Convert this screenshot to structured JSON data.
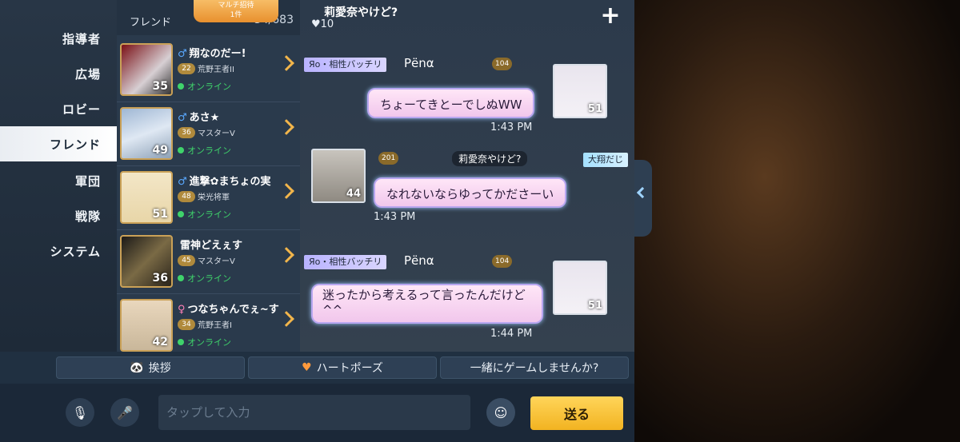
{
  "nav": {
    "items": [
      {
        "label": "指導者"
      },
      {
        "label": "広場"
      },
      {
        "label": "ロビー"
      },
      {
        "label": "フレンド",
        "active": true
      },
      {
        "label": "軍団"
      },
      {
        "label": "戦隊"
      },
      {
        "label": "システム"
      }
    ]
  },
  "friends": {
    "title": "フレンド",
    "count": "34/683",
    "multi_badge_line1": "マルチ招待",
    "multi_badge_line2": "1件",
    "list": [
      {
        "gender": "♂",
        "name": "翔なのだー!",
        "star": "22",
        "rank": "荒野王者II",
        "status": "オンライン",
        "level": "35"
      },
      {
        "gender": "♂",
        "name": "あさ★",
        "star": "36",
        "rank": "マスターV",
        "status": "オンライン",
        "level": "49"
      },
      {
        "gender": "♂",
        "name": "進撃✿まちょの実",
        "star": "48",
        "rank": "栄光将軍",
        "status": "オンライン",
        "level": "51"
      },
      {
        "gender": "",
        "name": "雷神どえぇす",
        "star": "45",
        "rank": "マスターV",
        "status": "オンライン",
        "level": "36"
      },
      {
        "gender": "♀",
        "name": "つなちゃんでぇ~す",
        "star": "34",
        "rank": "荒野王者I",
        "status": "オンライン",
        "level": "42"
      }
    ]
  },
  "chat": {
    "title": "莉愛奈やけど?",
    "hearts": "♥10",
    "messages": [
      {
        "tag": "Яo・相性バッチリ",
        "user": "Pёnα",
        "star": "104",
        "text": "ちょーてきとーでしぬWW",
        "time": "1:43 PM",
        "level": "51"
      },
      {
        "star": "201",
        "user": "莉愛奈やけど?",
        "tag": "大翔だじ",
        "text": "なれないならゆってかださーい",
        "time": "1:43 PM",
        "level": "44"
      },
      {
        "tag": "Яo・相性バッチリ",
        "user": "Pёnα",
        "star": "104",
        "text": "迷ったから考えるって言ったんだけど^^",
        "time": "1:44 PM",
        "level": "51"
      }
    ]
  },
  "quick": {
    "greet": "挨拶",
    "heart_pose": "ハートポーズ",
    "invite": "一緒にゲームしませんか?"
  },
  "input": {
    "placeholder": "タップして入力",
    "send": "送る"
  }
}
